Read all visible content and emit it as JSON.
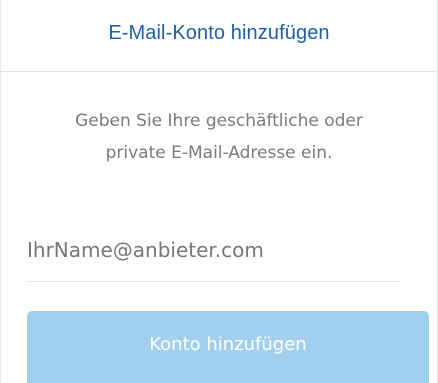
{
  "header": {
    "title": "E-Mail-Konto hinzufügen"
  },
  "instructions": {
    "line1": "Geben Sie Ihre geschäftliche oder",
    "line2": "private E-Mail-Adresse ein."
  },
  "email": {
    "placeholder": "IhrName@anbieter.com",
    "value": ""
  },
  "button": {
    "label": "Konto hinzufügen",
    "disabled": true
  },
  "colors": {
    "title": "#1d5fa8",
    "button_bg": "#a3cfee",
    "button_text": "#ffffff",
    "body_text": "#7a7a7a"
  }
}
